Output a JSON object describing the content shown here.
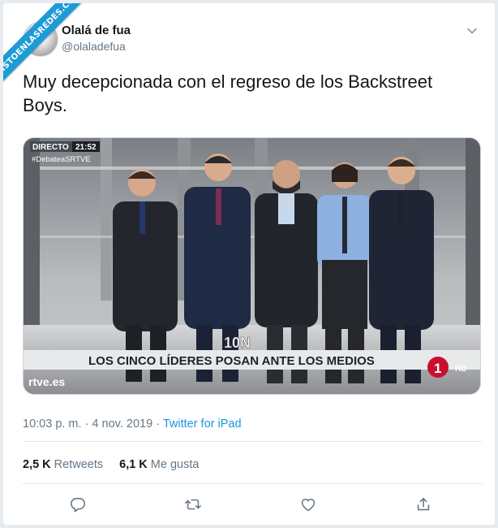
{
  "watermark": {
    "text": "VISTOENLASREDES.COM"
  },
  "tweet": {
    "user_name": "Olalá de fua",
    "user_handle": "@olaladefua",
    "text": "Muy decepcionada con el regreso de los Backstreet Boys.",
    "time": "10:03 p. m.",
    "separator": "·",
    "date": "4 nov. 2019",
    "source": "Twitter for iPad"
  },
  "media": {
    "live_label": "DIRECTO",
    "live_time": "21:52",
    "hashtag": "#DebateaSRTVE",
    "event_logo": "10N",
    "lower_third": "LOS CINCO LÍDERES POSAN ANTE LOS MEDIOS",
    "broadcaster": "rtve.es",
    "channel_number": "1",
    "channel_hd": "HD"
  },
  "stats": {
    "retweets_count": "2,5 K",
    "retweets_label": "Retweets",
    "likes_count": "6,1 K",
    "likes_label": "Me gusta"
  },
  "actions": {
    "reply_icon": "reply-icon",
    "retweet_icon": "retweet-icon",
    "like_icon": "like-icon",
    "share_icon": "share-icon"
  },
  "colors": {
    "link_blue": "#1b95e0",
    "secondary_text": "#657786",
    "watermark_blue": "#1d9bd7"
  }
}
